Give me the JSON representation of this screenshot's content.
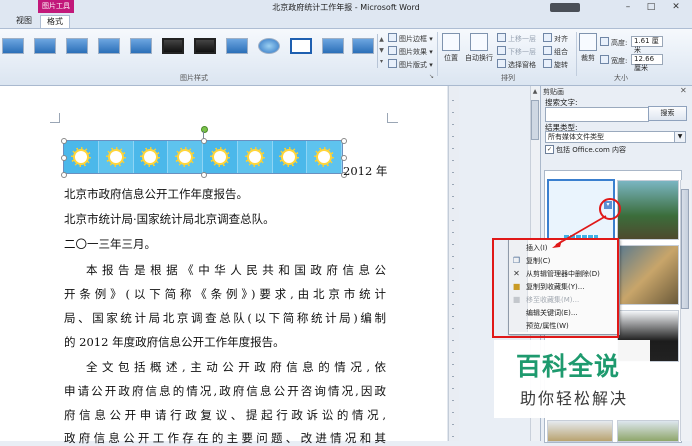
{
  "window": {
    "title": "北京政府统计工作年报 - Microsoft Word",
    "context_tab": "图片工具"
  },
  "tabs": [
    {
      "label": "视图"
    },
    {
      "label": "格式"
    }
  ],
  "ribbon": {
    "border_cmds": [
      "图片边框",
      "图片效果",
      "图片版式"
    ],
    "group_picture_styles": "图片样式",
    "arrange": {
      "position": "位置",
      "wrap": "自动换行",
      "bring_forward": "上移一层",
      "send_backward": "下移一层",
      "selection_pane": "选择窗格",
      "align": "对齐",
      "group": "组合",
      "rotate": "旋转",
      "group_label": "排列"
    },
    "size": {
      "crop": "裁剪",
      "height_label": "高度:",
      "height_value": "1.61 厘米",
      "width_label": "宽度:",
      "width_value": "12.66 厘米",
      "group_label": "大小"
    }
  },
  "document": {
    "line1_tail": "2012 年",
    "line2": "北京市政府信息公开工作年度报告。",
    "line3": "北京市统计局·国家统计局北京调查总队。",
    "line4": "二〇一三年三月。",
    "para1": [
      "本报告是根据《中华人民共和国政府信息公",
      "开条例》(以下简称《条例》)要求,由北京市统计",
      "局、国家统计局北京调查总队(以下简称统计局)编制",
      "的 2012 年度政府信息公开工作年度报告。"
    ],
    "para2": [
      "全文包括概述,主动公开政府信息的情况,依",
      "申请公开政府信息的情况,政府信息公开咨询情况,因政",
      "府信息公开申请行政复议、提起行政诉讼的情况,",
      "政府信息公开工作存在的主要问题、改进情况和其"
    ]
  },
  "clipart_pane": {
    "title": "剪贴画",
    "search_label": "搜索文字:",
    "search_value": "",
    "search_button": "搜索",
    "type_label": "结果类型:",
    "type_value": "所有媒体文件类型",
    "include_office_label": "包括 Office.com 内容",
    "include_office_checked": true
  },
  "context_menu": {
    "items": [
      {
        "label": "插入(I)",
        "icon": "none",
        "enabled": true
      },
      {
        "label": "复制(C)",
        "icon": "copy-icon",
        "enabled": true
      },
      {
        "label": "从剪辑管理器中删除(D)",
        "icon": "delete-icon",
        "enabled": true
      },
      {
        "label": "复制到收藏集(Y)...",
        "icon": "collection-icon",
        "enabled": true
      },
      {
        "label": "移至收藏集(M)...",
        "icon": "move-icon",
        "enabled": false
      },
      {
        "label": "编辑关键词(E)...",
        "icon": "none",
        "enabled": true
      },
      {
        "label": "预览/属性(W)",
        "icon": "none",
        "enabled": true
      }
    ]
  },
  "watermark": {
    "main": "百科全说",
    "sub": "助你轻松解决"
  },
  "colors": {
    "context_tab": "#c2187a",
    "annotation_red": "#e01818",
    "watermark_green": "#1e9a6e"
  }
}
